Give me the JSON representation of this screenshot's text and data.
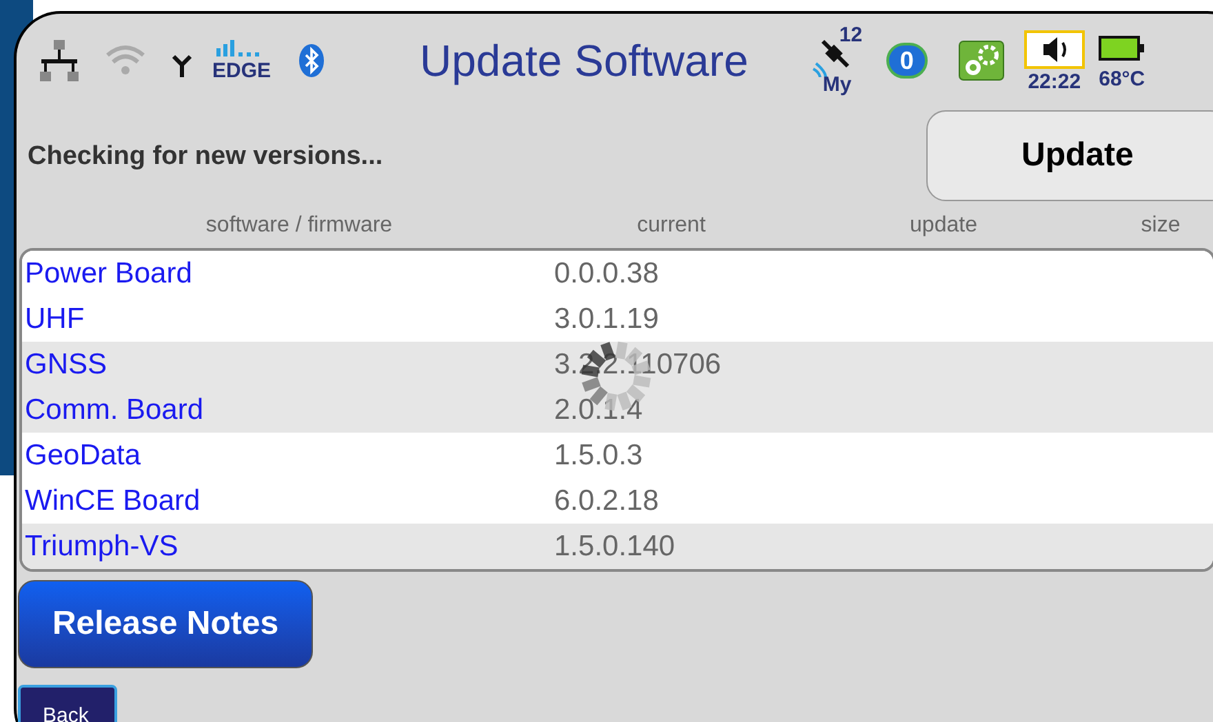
{
  "status_bar": {
    "network_label": "EDGE",
    "satellites": "12",
    "satellite_label": "My",
    "globe_count": "0",
    "time": "22:22",
    "temperature": "68°C",
    "wifi_on": false
  },
  "window": {
    "title": "Update Software"
  },
  "status_message": "Checking for new versions...",
  "update_button": "Update",
  "table": {
    "columns": [
      "software / firmware",
      "current",
      "update",
      "size"
    ],
    "rows": [
      {
        "name": "Power Board",
        "current": "0.0.0.38"
      },
      {
        "name": "UHF",
        "current": "3.0.1.19"
      },
      {
        "name": "GNSS",
        "current": "3.2.2.110706"
      },
      {
        "name": "Comm. Board",
        "current": "2.0.1.4"
      },
      {
        "name": "GeoData",
        "current": "1.5.0.3"
      },
      {
        "name": "WinCE Board",
        "current": "6.0.2.18"
      },
      {
        "name": "Triumph-VS",
        "current": "1.5.0.140"
      }
    ]
  },
  "loading": true,
  "release_notes_button": "Release Notes",
  "back_button": "Back"
}
